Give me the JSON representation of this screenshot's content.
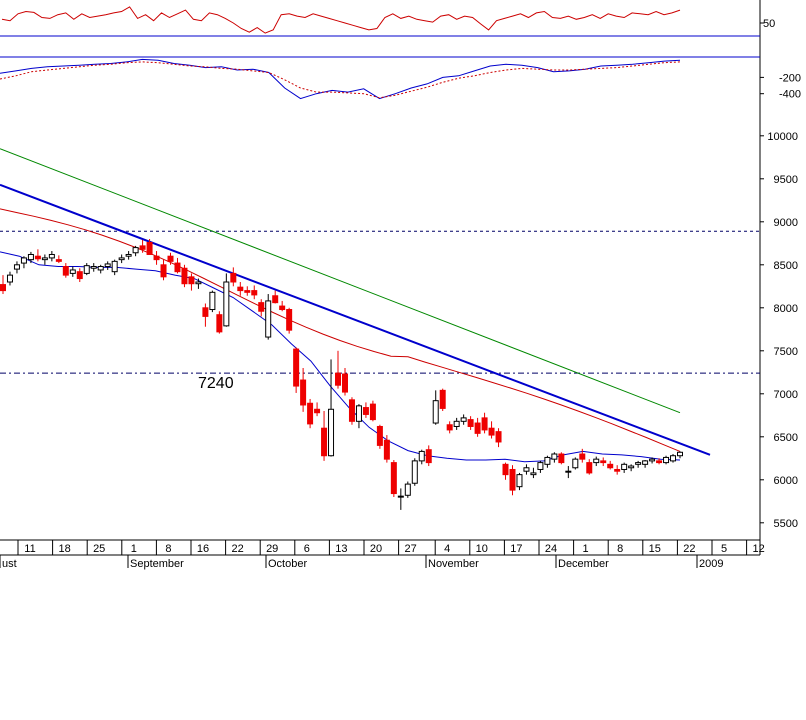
{
  "chart_data": [
    {
      "type": "line",
      "name": "oscillator",
      "ylim": [
        0,
        100
      ],
      "reference_line": 40,
      "y_ticks": [
        50
      ],
      "values": [
        58,
        55,
        70,
        75,
        73,
        62,
        60,
        68,
        72,
        58,
        70,
        62,
        65,
        68,
        72,
        75,
        85,
        60,
        68,
        55,
        72,
        62,
        70,
        78,
        58,
        55,
        72,
        68,
        60,
        50,
        38,
        30,
        40,
        28,
        35,
        68,
        70,
        65,
        62,
        70,
        65,
        60,
        55,
        50,
        45,
        40,
        35,
        38,
        62,
        70,
        60,
        65,
        58,
        55,
        52,
        65,
        68,
        58,
        65,
        62,
        48,
        35,
        55,
        60,
        65,
        70,
        62,
        72,
        75,
        62,
        60,
        65,
        58,
        62,
        68,
        60,
        70,
        65,
        62,
        72,
        70,
        68,
        75,
        68,
        72,
        78
      ]
    },
    {
      "type": "line",
      "name": "macd",
      "ylim": [
        -600,
        50
      ],
      "reference_line": 0,
      "y_ticks": [
        -200,
        -400
      ],
      "series": [
        {
          "color": "#0000cc",
          "style": "solid",
          "values": [
            -150,
            -120,
            -90,
            -70,
            -60,
            -50,
            -40,
            -30,
            -10,
            20,
            10,
            -30,
            -50,
            -80,
            -70,
            -110,
            -100,
            -140,
            -330,
            -460,
            -400,
            -360,
            -380,
            -340,
            -460,
            -400,
            -330,
            -280,
            -200,
            -180,
            -120,
            -60,
            -40,
            -50,
            -80,
            -130,
            -120,
            -100,
            -60,
            -50,
            -40,
            -20,
            0,
            10
          ]
        },
        {
          "color": "#cc0000",
          "style": "dashed",
          "values": [
            -220,
            -180,
            -130,
            -110,
            -90,
            -70,
            -50,
            -40,
            -20,
            -10,
            -20,
            -40,
            -60,
            -70,
            -90,
            -100,
            -120,
            -140,
            -230,
            -330,
            -380,
            -380,
            -390,
            -400,
            -450,
            -420,
            -370,
            -320,
            -260,
            -210,
            -180,
            -140,
            -110,
            -90,
            -100,
            -110,
            -110,
            -100,
            -90,
            -80,
            -60,
            -40,
            -20,
            -10
          ]
        }
      ]
    },
    {
      "type": "candlestick",
      "name": "price",
      "ylim": [
        5300,
        10300
      ],
      "y_ticks": [
        5500,
        6000,
        6500,
        7000,
        7500,
        8000,
        8500,
        9000,
        9500,
        10000
      ],
      "x_tick_labels": [
        "11",
        "18",
        "25",
        "1",
        "8",
        "16",
        "22",
        "29",
        "6",
        "13",
        "20",
        "27",
        "4",
        "10",
        "17",
        "24",
        "1",
        "8",
        "15",
        "22",
        "5",
        "12"
      ],
      "month_labels": [
        "ust",
        "September",
        "October",
        "November",
        "December",
        "2009"
      ],
      "horizontal_levels": [
        8890,
        7240
      ],
      "annotation": "7240",
      "trendline": {
        "start": 9430,
        "end": 6290
      },
      "ma_long": {
        "start": 9850,
        "end": 6780
      },
      "ma_mid": {
        "start": 9150,
        "end": 6330
      },
      "ma_short": [
        8650,
        8600,
        8500,
        8480,
        8480,
        8470,
        8470,
        8450,
        8430,
        8380,
        8340,
        8230,
        8120,
        7960,
        7800,
        7580,
        7380,
        7090,
        6830,
        6610,
        6450,
        6340,
        6280,
        6250,
        6230,
        6230,
        6240,
        6210,
        6220,
        6290,
        6330,
        6300,
        6290,
        6270,
        6240,
        6230
      ],
      "candles": [
        {
          "o": 8270,
          "h": 8380,
          "l": 8160,
          "c": 8200
        },
        {
          "o": 8300,
          "h": 8420,
          "l": 8260,
          "c": 8380
        },
        {
          "o": 8450,
          "h": 8540,
          "l": 8400,
          "c": 8500
        },
        {
          "o": 8520,
          "h": 8600,
          "l": 8460,
          "c": 8580
        },
        {
          "o": 8560,
          "h": 8650,
          "l": 8520,
          "c": 8620
        },
        {
          "o": 8600,
          "h": 8680,
          "l": 8540,
          "c": 8570
        },
        {
          "o": 8560,
          "h": 8620,
          "l": 8500,
          "c": 8580
        },
        {
          "o": 8580,
          "h": 8660,
          "l": 8540,
          "c": 8620
        },
        {
          "o": 8560,
          "h": 8610,
          "l": 8520,
          "c": 8540
        },
        {
          "o": 8480,
          "h": 8520,
          "l": 8350,
          "c": 8380
        },
        {
          "o": 8400,
          "h": 8480,
          "l": 8360,
          "c": 8440
        },
        {
          "o": 8420,
          "h": 8460,
          "l": 8300,
          "c": 8340
        },
        {
          "o": 8400,
          "h": 8520,
          "l": 8380,
          "c": 8490
        },
        {
          "o": 8460,
          "h": 8520,
          "l": 8420,
          "c": 8480
        },
        {
          "o": 8440,
          "h": 8500,
          "l": 8400,
          "c": 8480
        },
        {
          "o": 8480,
          "h": 8540,
          "l": 8440,
          "c": 8510
        },
        {
          "o": 8420,
          "h": 8560,
          "l": 8380,
          "c": 8540
        },
        {
          "o": 8560,
          "h": 8620,
          "l": 8520,
          "c": 8580
        },
        {
          "o": 8600,
          "h": 8660,
          "l": 8560,
          "c": 8620
        },
        {
          "o": 8640,
          "h": 8720,
          "l": 8600,
          "c": 8700
        },
        {
          "o": 8720,
          "h": 8790,
          "l": 8640,
          "c": 8680
        },
        {
          "o": 8760,
          "h": 8800,
          "l": 8640,
          "c": 8620
        },
        {
          "o": 8600,
          "h": 8660,
          "l": 8500,
          "c": 8560
        },
        {
          "o": 8500,
          "h": 8560,
          "l": 8320,
          "c": 8360
        },
        {
          "o": 8600,
          "h": 8640,
          "l": 8500,
          "c": 8540
        },
        {
          "o": 8520,
          "h": 8580,
          "l": 8400,
          "c": 8420
        },
        {
          "o": 8460,
          "h": 8500,
          "l": 8240,
          "c": 8280
        },
        {
          "o": 8360,
          "h": 8400,
          "l": 8200,
          "c": 8280
        },
        {
          "o": 8280,
          "h": 8340,
          "l": 8220,
          "c": 8300
        },
        {
          "o": 8000,
          "h": 8050,
          "l": 7780,
          "c": 7900
        },
        {
          "o": 7980,
          "h": 8200,
          "l": 7950,
          "c": 8180
        },
        {
          "o": 7920,
          "h": 7960,
          "l": 7700,
          "c": 7720
        },
        {
          "o": 7790,
          "h": 8400,
          "l": 7780,
          "c": 8300
        },
        {
          "o": 8400,
          "h": 8470,
          "l": 8250,
          "c": 8300
        },
        {
          "o": 8240,
          "h": 8300,
          "l": 8140,
          "c": 8200
        },
        {
          "o": 8200,
          "h": 8250,
          "l": 8140,
          "c": 8180
        },
        {
          "o": 8200,
          "h": 8260,
          "l": 8100,
          "c": 8150
        },
        {
          "o": 8060,
          "h": 8100,
          "l": 7900,
          "c": 7960
        },
        {
          "o": 7660,
          "h": 8160,
          "l": 7630,
          "c": 8080
        },
        {
          "o": 8140,
          "h": 8200,
          "l": 8050,
          "c": 8060
        },
        {
          "o": 8020,
          "h": 8080,
          "l": 7960,
          "c": 7980
        },
        {
          "o": 7980,
          "h": 8000,
          "l": 7700,
          "c": 7740
        },
        {
          "o": 7520,
          "h": 7540,
          "l": 7010,
          "c": 7090
        },
        {
          "o": 7160,
          "h": 7300,
          "l": 6790,
          "c": 6870
        },
        {
          "o": 6890,
          "h": 6940,
          "l": 6600,
          "c": 6650
        },
        {
          "o": 6820,
          "h": 6900,
          "l": 6740,
          "c": 6780
        },
        {
          "o": 6600,
          "h": 6800,
          "l": 6220,
          "c": 6280
        },
        {
          "o": 6280,
          "h": 7400,
          "l": 6270,
          "c": 6820
        },
        {
          "o": 7240,
          "h": 7500,
          "l": 7060,
          "c": 7100
        },
        {
          "o": 7230,
          "h": 7300,
          "l": 6980,
          "c": 7020
        },
        {
          "o": 6930,
          "h": 6960,
          "l": 6640,
          "c": 6680
        },
        {
          "o": 6680,
          "h": 6880,
          "l": 6600,
          "c": 6860
        },
        {
          "o": 6840,
          "h": 6900,
          "l": 6720,
          "c": 6760
        },
        {
          "o": 6880,
          "h": 6920,
          "l": 6680,
          "c": 6700
        },
        {
          "o": 6620,
          "h": 6640,
          "l": 6360,
          "c": 6400
        },
        {
          "o": 6460,
          "h": 6520,
          "l": 6200,
          "c": 6240
        },
        {
          "o": 6200,
          "h": 6230,
          "l": 5800,
          "c": 5840
        },
        {
          "o": 5800,
          "h": 5900,
          "l": 5650,
          "c": 5810
        },
        {
          "o": 5820,
          "h": 5980,
          "l": 5790,
          "c": 5950
        },
        {
          "o": 5960,
          "h": 6250,
          "l": 5930,
          "c": 6220
        },
        {
          "o": 6220,
          "h": 6350,
          "l": 6180,
          "c": 6330
        },
        {
          "o": 6350,
          "h": 6400,
          "l": 6160,
          "c": 6200
        },
        {
          "o": 6660,
          "h": 7040,
          "l": 6640,
          "c": 6920
        },
        {
          "o": 7040,
          "h": 7060,
          "l": 6800,
          "c": 6830
        },
        {
          "o": 6640,
          "h": 6680,
          "l": 6540,
          "c": 6580
        },
        {
          "o": 6620,
          "h": 6720,
          "l": 6580,
          "c": 6680
        },
        {
          "o": 6680,
          "h": 6760,
          "l": 6640,
          "c": 6720
        },
        {
          "o": 6700,
          "h": 6740,
          "l": 6580,
          "c": 6620
        },
        {
          "o": 6660,
          "h": 6720,
          "l": 6500,
          "c": 6540
        },
        {
          "o": 6720,
          "h": 6780,
          "l": 6540,
          "c": 6580
        },
        {
          "o": 6600,
          "h": 6680,
          "l": 6480,
          "c": 6520
        },
        {
          "o": 6560,
          "h": 6600,
          "l": 6380,
          "c": 6440
        },
        {
          "o": 6180,
          "h": 6200,
          "l": 6000,
          "c": 6060
        },
        {
          "o": 6120,
          "h": 6170,
          "l": 5820,
          "c": 5880
        },
        {
          "o": 5920,
          "h": 6080,
          "l": 5880,
          "c": 6060
        },
        {
          "o": 6100,
          "h": 6180,
          "l": 6060,
          "c": 6140
        },
        {
          "o": 6060,
          "h": 6140,
          "l": 6020,
          "c": 6080
        },
        {
          "o": 6120,
          "h": 6220,
          "l": 6080,
          "c": 6200
        },
        {
          "o": 6180,
          "h": 6280,
          "l": 6140,
          "c": 6260
        },
        {
          "o": 6240,
          "h": 6320,
          "l": 6200,
          "c": 6300
        },
        {
          "o": 6300,
          "h": 6320,
          "l": 6180,
          "c": 6200
        },
        {
          "o": 6100,
          "h": 6160,
          "l": 6020,
          "c": 6100
        },
        {
          "o": 6140,
          "h": 6260,
          "l": 6120,
          "c": 6240
        },
        {
          "o": 6300,
          "h": 6360,
          "l": 6200,
          "c": 6240
        },
        {
          "o": 6200,
          "h": 6240,
          "l": 6060,
          "c": 6080
        },
        {
          "o": 6200,
          "h": 6270,
          "l": 6160,
          "c": 6240
        },
        {
          "o": 6220,
          "h": 6260,
          "l": 6160,
          "c": 6200
        },
        {
          "o": 6180,
          "h": 6220,
          "l": 6120,
          "c": 6140
        },
        {
          "o": 6120,
          "h": 6170,
          "l": 6060,
          "c": 6100
        },
        {
          "o": 6120,
          "h": 6200,
          "l": 6080,
          "c": 6180
        },
        {
          "o": 6140,
          "h": 6180,
          "l": 6100,
          "c": 6160
        },
        {
          "o": 6180,
          "h": 6220,
          "l": 6140,
          "c": 6200
        },
        {
          "o": 6180,
          "h": 6230,
          "l": 6140,
          "c": 6220
        },
        {
          "o": 6220,
          "h": 6260,
          "l": 6190,
          "c": 6240
        },
        {
          "o": 6220,
          "h": 6250,
          "l": 6180,
          "c": 6200
        },
        {
          "o": 6200,
          "h": 6280,
          "l": 6180,
          "c": 6260
        },
        {
          "o": 6220,
          "h": 6300,
          "l": 6200,
          "c": 6280
        },
        {
          "o": 6280,
          "h": 6330,
          "l": 6250,
          "c": 6320
        }
      ]
    }
  ]
}
